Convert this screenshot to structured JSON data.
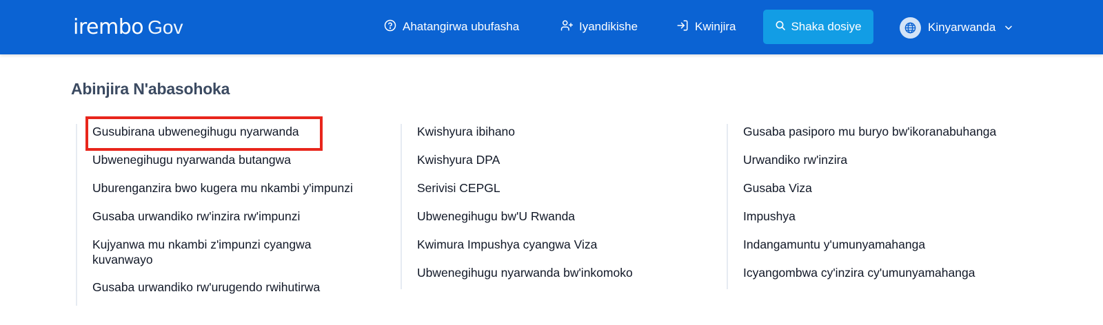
{
  "header": {
    "logo_brand": "irembo",
    "logo_suffix": "Gov",
    "nav": [
      {
        "label": "Ahatangirwa ubufasha",
        "icon": "help-circle-icon"
      },
      {
        "label": "Iyandikishe",
        "icon": "user-plus-icon"
      },
      {
        "label": "Kwinjira",
        "icon": "login-icon"
      }
    ],
    "search_label": "Shaka dosiye",
    "search_icon": "search-icon",
    "language": {
      "label": "Kinyarwanda",
      "icon": "globe-icon"
    }
  },
  "section": {
    "title": "Abinjira N'abasohoka",
    "columns": [
      [
        "Gusubirana ubwenegihugu nyarwanda",
        "Ubwenegihugu nyarwanda butangwa",
        "Uburenganzira bwo kugera mu nkambi y'impunzi",
        "Gusaba urwandiko rw'inzira rw'impunzi",
        "Kujyanwa mu nkambi z'impunzi cyangwa kuvanwayo",
        "Gusaba urwandiko rw'urugendo rwihutirwa"
      ],
      [
        "Kwishyura ibihano",
        "Kwishyura DPA",
        "Serivisi CEPGL",
        "Ubwenegihugu bw'U Rwanda",
        "Kwimura Impushya cyangwa Viza",
        "Ubwenegihugu nyarwanda bw'inkomoko"
      ],
      [
        "Gusaba pasiporo mu buryo bw'ikoranabuhanga",
        "Urwandiko rw'inzira",
        "Gusaba Viza",
        "Impushya",
        "Indangamuntu y'umunyamahanga",
        "Icyangombwa cy'inzira cy'umunyamahanga"
      ]
    ]
  },
  "colors": {
    "header_bg": "#0b63d3",
    "search_bg": "#129de5",
    "highlight": "#e8261c"
  }
}
